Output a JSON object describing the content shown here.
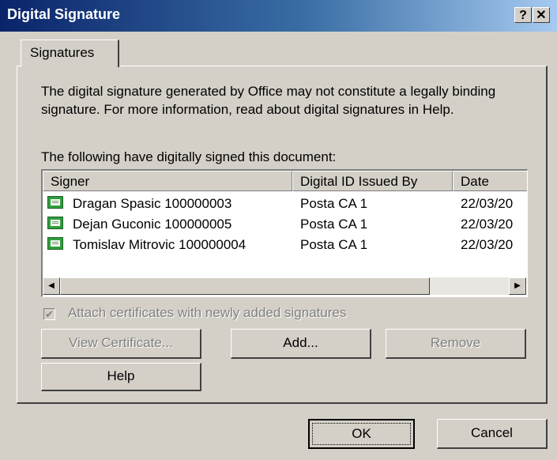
{
  "window": {
    "title": "Digital Signature",
    "help_glyph": "?",
    "close_glyph": "✕"
  },
  "tab": {
    "label": "Signatures"
  },
  "description": "The digital signature generated by Office may not constitute a legally binding signature. For more information, read about digital signatures in Help.",
  "list_heading": "The following have digitally signed this document:",
  "table": {
    "headers": [
      "Signer",
      "Digital ID Issued By",
      "Date"
    ],
    "rows": [
      {
        "signer": "Dragan Spasic 100000003",
        "issuer": "Posta CA 1",
        "date": "22/03/20"
      },
      {
        "signer": "Dejan Guconic 100000005",
        "issuer": "Posta CA 1",
        "date": "22/03/20"
      },
      {
        "signer": "Tomislav Mitrovic 100000004",
        "issuer": "Posta CA 1",
        "date": "22/03/20"
      }
    ]
  },
  "scrollbar": {
    "left_glyph": "◀",
    "right_glyph": "▶"
  },
  "attach_checkbox": {
    "label": "Attach certificates with newly added signatures",
    "checked": true,
    "check_glyph": "✔"
  },
  "buttons": {
    "view_certificate": "View Certificate...",
    "add": "Add...",
    "remove": "Remove",
    "help": "Help",
    "ok": "OK",
    "cancel": "Cancel"
  },
  "colors": {
    "title_start": "#0a246a",
    "title_end": "#a6caf0",
    "face": "#d4d0c8"
  }
}
